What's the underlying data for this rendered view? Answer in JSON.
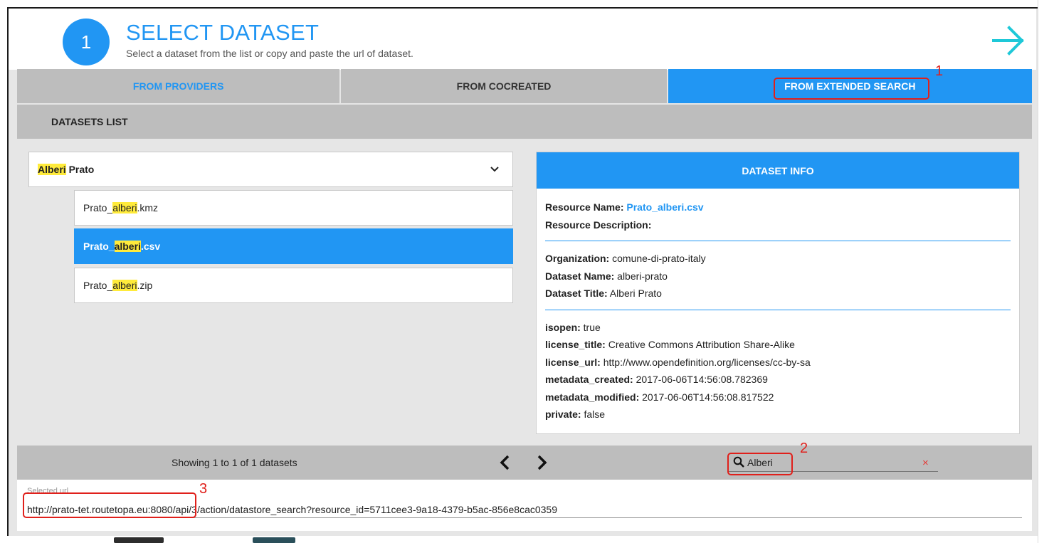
{
  "header": {
    "step_number": "1",
    "title": "SELECT DATASET",
    "subtitle": "Select a dataset from the list or copy and paste the url of dataset."
  },
  "tabs": [
    {
      "label": "FROM PROVIDERS"
    },
    {
      "label": "FROM COCREATED"
    },
    {
      "label": "FROM EXTENDED SEARCH"
    }
  ],
  "section": {
    "title": "DATASETS LIST"
  },
  "dataset_group": {
    "highlight": "Alberi",
    "rest": " Prato"
  },
  "resources": [
    {
      "prefix": "Prato_",
      "highlight": "alberi",
      "suffix": ".kmz"
    },
    {
      "prefix": "Prato_",
      "highlight": "alberi",
      "suffix": ".csv"
    },
    {
      "prefix": "Prato_",
      "highlight": "alberi",
      "suffix": ".zip"
    }
  ],
  "info": {
    "title": "DATASET INFO",
    "resource_name_label": "Resource Name:",
    "resource_name_value": "Prato_alberi.csv",
    "resource_desc_label": "Resource Description:",
    "organization_label": "Organization:",
    "organization_value": "comune-di-prato-italy",
    "dataset_name_label": "Dataset Name:",
    "dataset_name_value": "alberi-prato",
    "dataset_title_label": "Dataset Title:",
    "dataset_title_value": "Alberi Prato",
    "meta": [
      {
        "label": "isopen:",
        "value": "true"
      },
      {
        "label": "license_title:",
        "value": "Creative Commons Attribution Share-Alike"
      },
      {
        "label": "license_url:",
        "value": "http://www.opendefinition.org/licenses/cc-by-sa"
      },
      {
        "label": "metadata_created:",
        "value": "2017-06-06T14:56:08.782369"
      },
      {
        "label": "metadata_modified:",
        "value": "2017-06-06T14:56:08.817522"
      },
      {
        "label": "private:",
        "value": "false"
      }
    ]
  },
  "footer": {
    "showing": "Showing 1 to 1 of 1 datasets",
    "search_value": "Alberi",
    "clear_symbol": "×"
  },
  "selected_url": {
    "label": "Selected url",
    "value": "http://prato-tet.routetopa.eu:8080/api/3/action/datastore_search?resource_id=5711cee3-9a18-4379-b5ac-856e8cac0359"
  },
  "annotations": [
    "1",
    "2",
    "3"
  ],
  "colors": {
    "accent": "#2196f3",
    "highlight": "#ffeb3b",
    "annotation": "#e0201b",
    "bar": "#bdbdbd"
  }
}
